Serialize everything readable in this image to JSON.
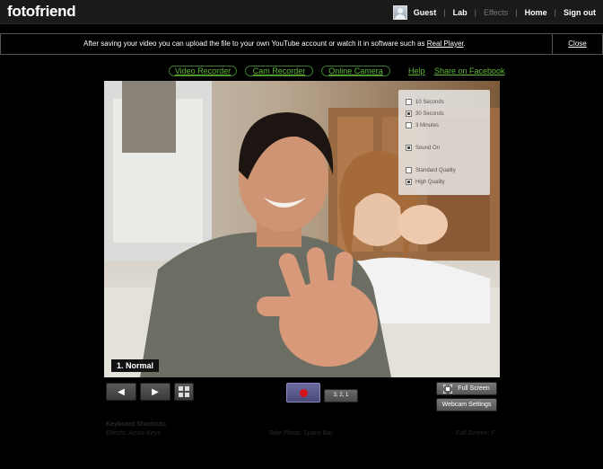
{
  "header": {
    "logo": "fotofriend",
    "nav": {
      "guest": "Guest",
      "lab": "Lab",
      "effects": "Effects",
      "home": "Home",
      "sign_out": "Sign out",
      "separator": "|"
    }
  },
  "notice": {
    "text_before": "After saving your video you can upload the file to your own YouTube account or watch it in software such as ",
    "link": "Real Player",
    "text_after": ".",
    "close": "Close"
  },
  "subnav": {
    "video_recorder": "Video Recorder",
    "cam_recorder": "Cam Recorder",
    "online_camera": "Online Camera",
    "help": "Help",
    "share": "Share on Facebook"
  },
  "video": {
    "mode_label": "1. Normal"
  },
  "options": [
    {
      "label": "10 Seconds",
      "checked": false
    },
    {
      "label": "30 Seconds",
      "checked": true
    },
    {
      "label": "3 Minutes",
      "checked": false
    },
    {
      "label": "Sound On",
      "checked": true
    },
    {
      "label": "Standard Quality",
      "checked": false
    },
    {
      "label": "High Quality",
      "checked": true
    }
  ],
  "controls": {
    "prev": "◀",
    "next": "▶",
    "countdown": "3, 2, 1",
    "full_screen": "Full Screen",
    "webcam_settings": "Webcam Settings"
  },
  "shortcuts": {
    "title": "Keyboard Shortcuts",
    "effects": "Effects: Arrow Keys",
    "photo": "Take Photo: Space Bar",
    "full": "Full Screen: F"
  },
  "colors": {
    "accent_green": "#5fba36",
    "record_red": "#d8141b"
  }
}
